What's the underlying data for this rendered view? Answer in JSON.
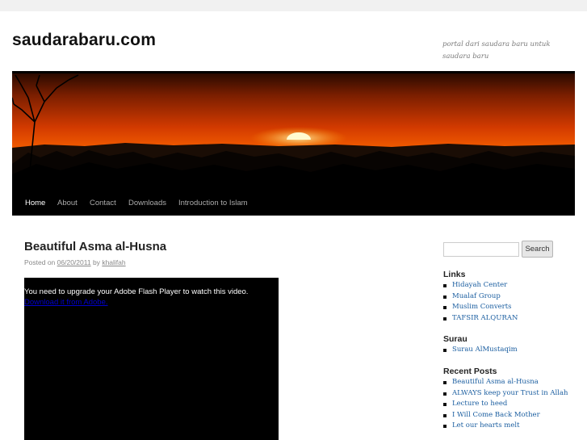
{
  "header": {
    "site_title": "saudarabaru.com",
    "site_description": "portal dari saudara baru untuk saudara baru"
  },
  "nav": {
    "items": [
      {
        "label": "Home",
        "active": true
      },
      {
        "label": "About"
      },
      {
        "label": "Contact"
      },
      {
        "label": "Downloads"
      },
      {
        "label": "Introduction to Islam"
      }
    ]
  },
  "post": {
    "title": "Beautiful Asma al-Husna",
    "posted_on_label": "Posted on",
    "date": "06/20/2011",
    "by_label": "by",
    "author": "khalifah",
    "video_message": "You need to upgrade your Adobe Flash Player to watch this video.",
    "video_link": "Download it from Adobe."
  },
  "sidebar": {
    "search_placeholder": "",
    "search_button": "Search",
    "links": {
      "title": "Links",
      "items": [
        "Hidayah Center",
        "Mualaf Group",
        "Muslim Converts",
        "TAFSIR ALQURAN"
      ]
    },
    "surau": {
      "title": "Surau",
      "items": [
        "Surau AlMustaqim"
      ]
    },
    "recent_posts": {
      "title": "Recent Posts",
      "items": [
        "Beautiful Asma al-Husna",
        "ALWAYS keep your Trust in Allah",
        "Lecture to heed",
        "I Will Come Back Mother",
        "Let our hearts melt"
      ]
    }
  },
  "colors": {
    "nav_bg": "#000000",
    "link": "#1b5ea0",
    "page_bg": "#f1f1f1"
  }
}
